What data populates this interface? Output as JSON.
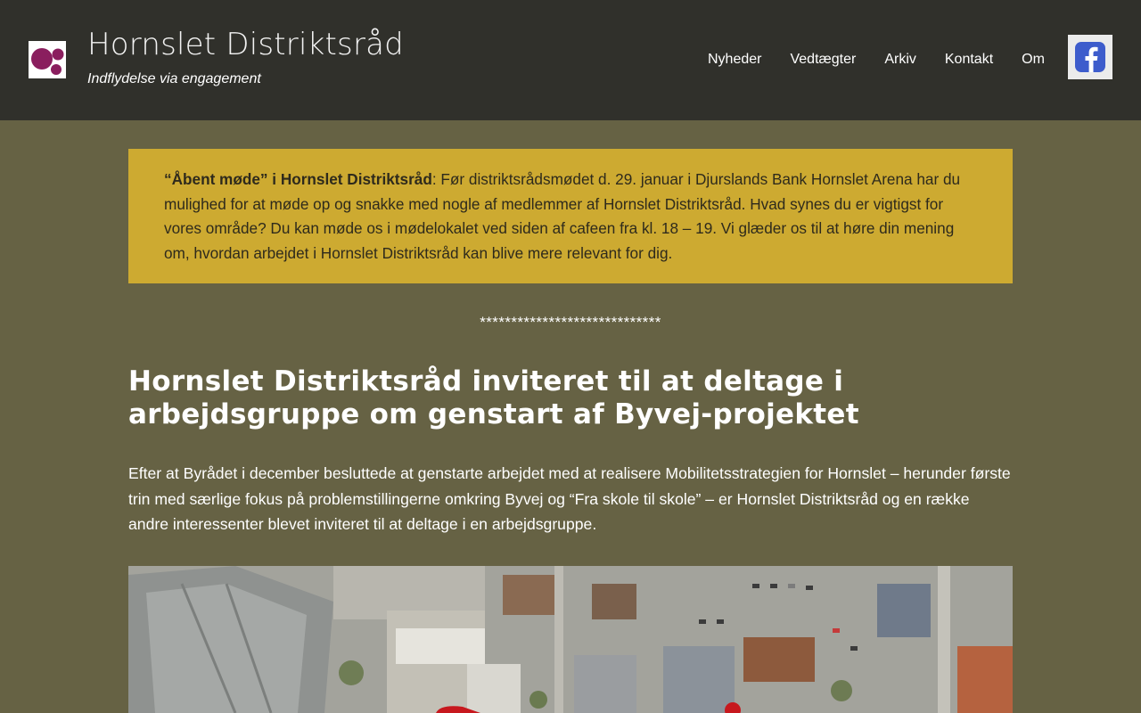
{
  "site": {
    "title": "Hornslet Distriktsråd",
    "tagline": "Indflydelse via engagement",
    "logo_icon": "three-purple-circles-logo",
    "brand_color": "#8a1e5e"
  },
  "nav": {
    "items": [
      "Nyheder",
      "Vedtægter",
      "Arkiv",
      "Kontakt",
      "Om"
    ],
    "facebook_icon": "facebook-icon"
  },
  "notice": {
    "bold": "“Åbent møde” i Hornslet Distriktsråd",
    "text": ": Før distriktsrådsmødet d. 29. januar i Djurslands Bank Hornslet Arena har du mulighed for at møde op og snakke med nogle af medlemmer af Hornslet Distriktsråd. Hvad synes du er vigtigst for vores område? Du kan møde os i mødelokalet ved siden af cafeen fra kl. 18 – 19. Vi glæder os til at høre din mening om, hvordan arbejdet i Hornslet Distriktsråd kan blive mere relevant for dig."
  },
  "separator": "*****************************",
  "article": {
    "headline": "Hornslet Distriktsråd inviteret til at deltage i arbejdsgruppe om genstart af Byvej-projektet",
    "body": "Efter at Byrådet i december besluttede at genstarte arbejdet med at realisere Mobilitetsstrategien for Hornslet – herunder første trin med særlige fokus på problemstillingerne omkring Byvej og “Fra skole til skole” – er Hornslet Distriktsråd og en række andre interessenter blevet inviteret til at deltage i en arbejdsgruppe.",
    "image": "aerial-photo-of-town-center"
  },
  "colors": {
    "header_bg": "#30302b",
    "page_bg": "#666244",
    "notice_bg": "#cdaa31"
  }
}
